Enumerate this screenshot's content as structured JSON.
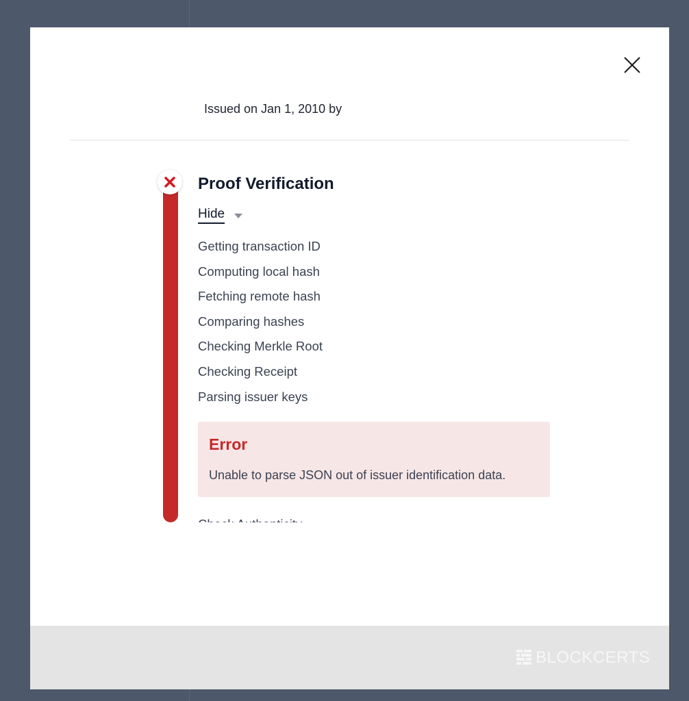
{
  "modal": {
    "issued_text": "Issued on Jan 1, 2010 by"
  },
  "verification": {
    "title": "Proof Verification",
    "status": "error",
    "toggle_label": "Hide",
    "steps": [
      "Getting transaction ID",
      "Computing local hash",
      "Fetching remote hash",
      "Comparing hashes",
      "Checking Merkle Root",
      "Checking Receipt",
      "Parsing issuer keys"
    ],
    "error": {
      "title": "Error",
      "message": "Unable to parse JSON out of issuer identification data."
    },
    "next_section": "Check Authenticity"
  },
  "footer": {
    "logo_text": "BLOCKCERTS"
  },
  "colors": {
    "error_red": "#c42a2a",
    "error_bg": "#f7e6e6",
    "backdrop": "#4e586b",
    "footer_bg": "#e4e4e4"
  },
  "icons": {
    "close": "close-icon",
    "status": "x-mark-icon",
    "toggle": "caret-down-icon",
    "logo": "blockcerts-logo-icon"
  }
}
